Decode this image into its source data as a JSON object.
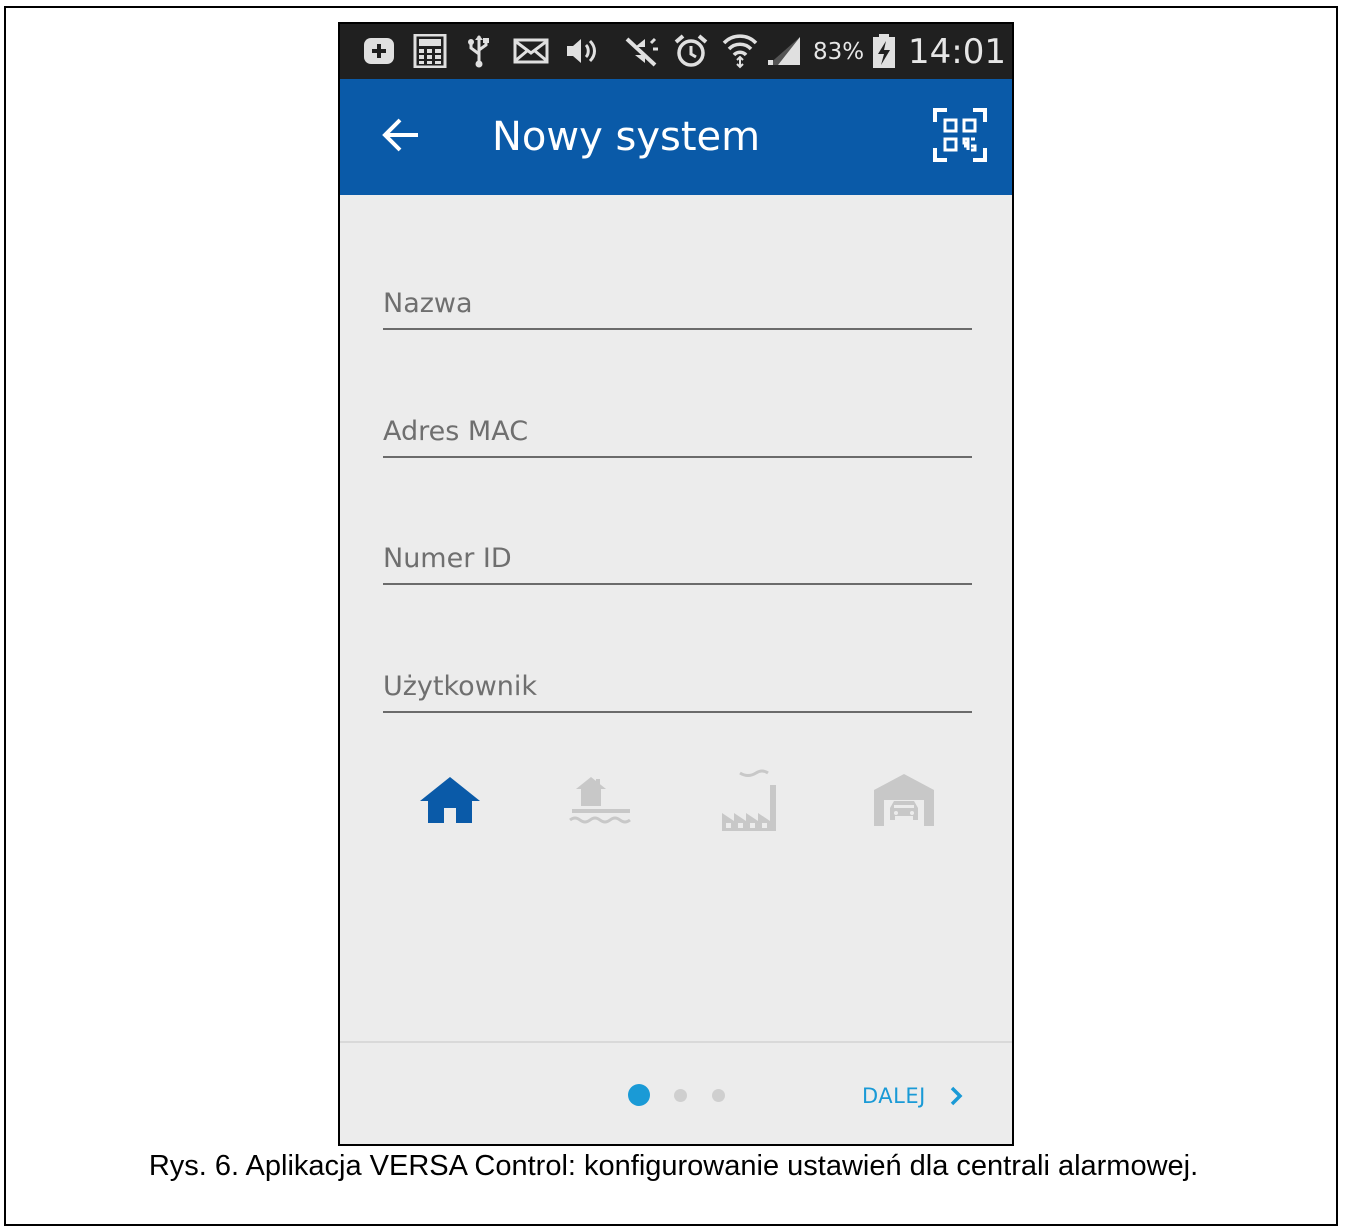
{
  "status_bar": {
    "battery_percent": "83%",
    "time": "14:01",
    "icons": [
      "plus-icon",
      "calculator-icon",
      "usb-icon",
      "mail-icon",
      "volume-icon",
      "mute-icon",
      "alarm-icon",
      "wifi-icon",
      "signal-icon",
      "battery-charging-icon"
    ]
  },
  "app_bar": {
    "title": "Nowy system",
    "back_icon": "arrow-left-icon",
    "qr_icon": "qr-scan-icon"
  },
  "form": {
    "name_placeholder": "Nazwa",
    "mac_placeholder": "Adres MAC",
    "id_placeholder": "Numer ID",
    "user_placeholder": "Użytkownik"
  },
  "object_types": {
    "items": [
      {
        "icon": "home-icon",
        "selected": true
      },
      {
        "icon": "lake-house-icon",
        "selected": false
      },
      {
        "icon": "factory-icon",
        "selected": false
      },
      {
        "icon": "garage-icon",
        "selected": false
      }
    ],
    "selected_color": "#0a5aa8",
    "unselected_color": "#c8c8c8"
  },
  "footer": {
    "page_count": 3,
    "current_page": 1,
    "next_label": "DALEJ",
    "next_icon": "chevron-right-icon",
    "accent": "#1a9ad6"
  },
  "caption": "Rys. 6. Aplikacja VERSA Control: konfigurowanie ustawień dla centrali alarmowej.",
  "colors": {
    "app_bar": "#0a5aa8",
    "status_bar": "#202020",
    "background": "#ececec"
  }
}
